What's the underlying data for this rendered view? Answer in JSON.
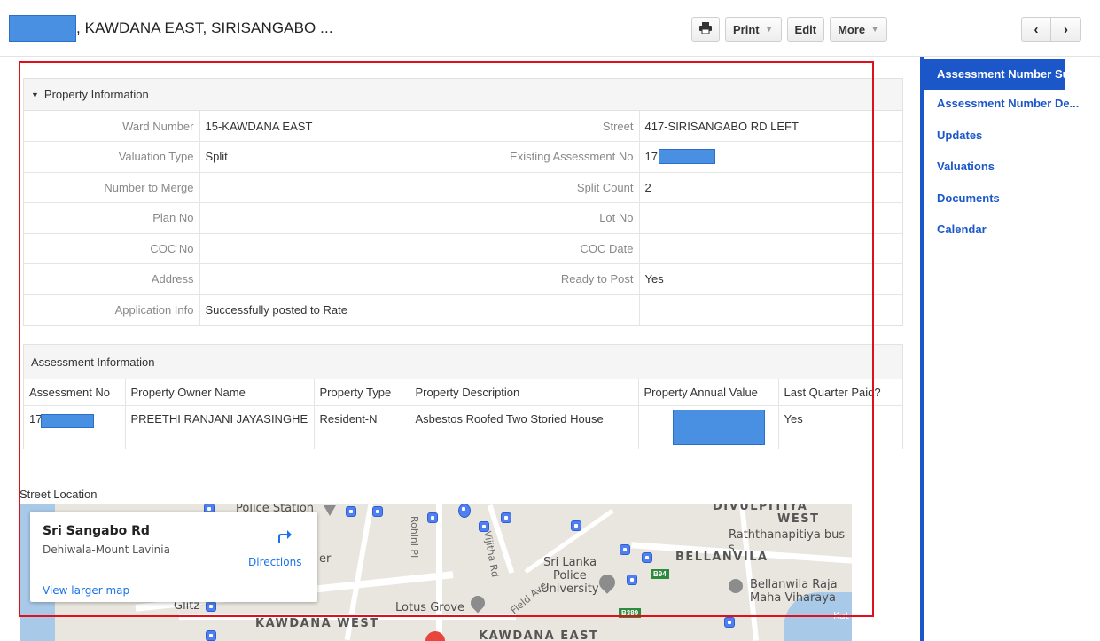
{
  "header": {
    "title": ", KAWDANA EAST, SIRISANGABO ...",
    "print_icon": "printer-icon",
    "print_label": "Print",
    "edit_label": "Edit",
    "more_label": "More",
    "prev_icon": "chevron-left-icon",
    "next_icon": "chevron-right-icon"
  },
  "property_info": {
    "section_title": "Property Information",
    "rows": [
      {
        "label1": "Ward Number",
        "value1": "15-KAWDANA EAST",
        "label2": "Street",
        "value2": "417-SIRISANGABO RD LEFT"
      },
      {
        "label1": "Valuation Type",
        "value1": "Split",
        "label2": "Existing Assessment No",
        "value2": "17"
      },
      {
        "label1": "Number to Merge",
        "value1": "",
        "label2": "Split Count",
        "value2": "2"
      },
      {
        "label1": "Plan No",
        "value1": "",
        "label2": "Lot No",
        "value2": ""
      },
      {
        "label1": "COC No",
        "value1": "",
        "label2": "COC Date",
        "value2": ""
      },
      {
        "label1": "Address",
        "value1": "",
        "label2": "Ready to Post",
        "value2": "Yes"
      },
      {
        "label1": "Application Info",
        "value1": "Successfully posted to Rate",
        "label2": "",
        "value2": ""
      }
    ]
  },
  "assessment_info": {
    "section_title": "Assessment Information",
    "columns": [
      "Assessment No",
      "Property Owner Name",
      "Property Type",
      "Property Description",
      "Property Annual Value",
      "Last Quarter Paid?"
    ],
    "rows": [
      {
        "assessment_no": "17",
        "owner": "PREETHI RANJANI JAYASINGHE",
        "type": "Resident-N",
        "description": "Asbestos Roofed Two Storied House",
        "annual_value": "",
        "last_quarter_paid": "Yes"
      }
    ]
  },
  "street_location": {
    "label": "Street Location",
    "card": {
      "title": "Sri Sangabo Rd",
      "subtitle": "Dehiwala-Mount Lavinia",
      "directions": "Directions",
      "larger_map": "View larger map"
    },
    "labels": {
      "police_station": "Police Station",
      "divulpitiya": "DIVULPITIYA",
      "west": "WEST",
      "raththanapitiya": "Raththanapitiya bus s",
      "bellanvila": "BELLANVILA",
      "sri_lanka": "Sri Lanka",
      "police": "Police",
      "university": "University",
      "bellanwila_raja": "Bellanwila Raja",
      "maha_viharaya": "Maha Viharaya",
      "glitz": "Glitz",
      "lotus_grove": "Lotus Grove",
      "kawdana_west": "KAWDANA WEST",
      "kawdana_east": "KAWDANA EAST",
      "rohini_pl": "Rohini Pl",
      "vijitha_rd": "Vijitha Rd",
      "field_ave": "Field Ave",
      "er": "er",
      "b94": "B94",
      "b389": "B389",
      "kat": "Kat"
    }
  },
  "sidebar": {
    "active": "Assessment Number Su...",
    "items": [
      "Assessment Number De...",
      "Updates",
      "Valuations",
      "Documents",
      "Calendar"
    ]
  },
  "colors": {
    "accent": "#1b57c9",
    "highlight_border": "#e0101a",
    "redaction": "#4a90e2"
  }
}
